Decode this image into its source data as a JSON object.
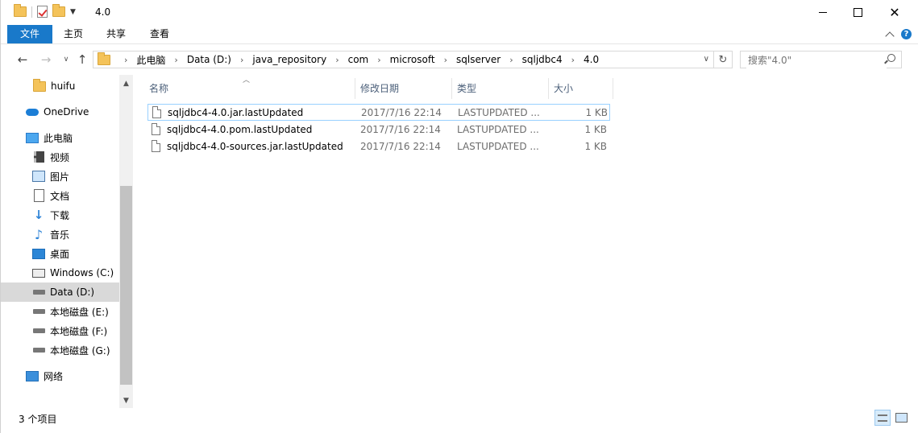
{
  "window": {
    "title": "4.0"
  },
  "ribbon": {
    "tabs": [
      "文件",
      "主页",
      "共享",
      "查看"
    ]
  },
  "address": {
    "crumbs": [
      "此电脑",
      "Data (D:)",
      "java_repository",
      "com",
      "microsoft",
      "sqlserver",
      "sqljdbc4",
      "4.0"
    ]
  },
  "search": {
    "placeholder": "搜索\"4.0\""
  },
  "nav_pane": {
    "items": [
      {
        "label": "huifu",
        "icon": "folder-icon"
      },
      {
        "label": "OneDrive",
        "icon": "onedrive-icon"
      },
      {
        "label": "此电脑",
        "icon": "this-pc-icon"
      },
      {
        "label": "视频",
        "icon": "videos-icon"
      },
      {
        "label": "图片",
        "icon": "pictures-icon"
      },
      {
        "label": "文档",
        "icon": "documents-icon"
      },
      {
        "label": "下载",
        "icon": "downloads-icon"
      },
      {
        "label": "音乐",
        "icon": "music-icon"
      },
      {
        "label": "桌面",
        "icon": "desktop-icon"
      },
      {
        "label": "Windows (C:)",
        "icon": "windows-drive-icon"
      },
      {
        "label": "Data (D:)",
        "icon": "drive-icon",
        "selected": true
      },
      {
        "label": "本地磁盘 (E:)",
        "icon": "drive-icon"
      },
      {
        "label": "本地磁盘 (F:)",
        "icon": "drive-icon"
      },
      {
        "label": "本地磁盘 (G:)",
        "icon": "drive-icon"
      },
      {
        "label": "网络",
        "icon": "network-icon"
      }
    ]
  },
  "file_list": {
    "columns": [
      "名称",
      "修改日期",
      "类型",
      "大小"
    ],
    "rows": [
      {
        "name": "sqljdbc4-4.0.jar.lastUpdated",
        "date": "2017/7/16 22:14",
        "type": "LASTUPDATED ...",
        "size": "1 KB"
      },
      {
        "name": "sqljdbc4-4.0.pom.lastUpdated",
        "date": "2017/7/16 22:14",
        "type": "LASTUPDATED ...",
        "size": "1 KB"
      },
      {
        "name": "sqljdbc4-4.0-sources.jar.lastUpdated",
        "date": "2017/7/16 22:14",
        "type": "LASTUPDATED ...",
        "size": "1 KB"
      }
    ]
  },
  "status": {
    "item_count": "3 个项目"
  },
  "colors": {
    "accent": "#1979ca",
    "selected_nav": "#d9d9d9",
    "header_text": "#4c607a"
  }
}
